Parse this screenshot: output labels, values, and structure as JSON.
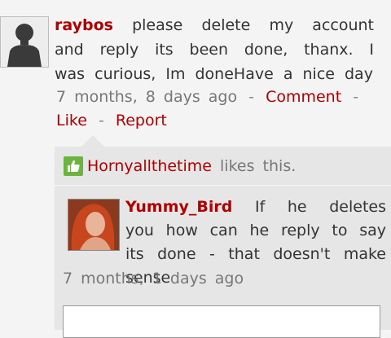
{
  "comment": {
    "username": "raybos",
    "text": "please delete my account and reply its been done, thanx. I was curious, Im doneHave a nice day",
    "time": "7 months, 8 days ago",
    "sep": "-",
    "comment_label": "Comment",
    "like_label": "Like",
    "report_label": "Report"
  },
  "likes": {
    "user": "Hornyallthetime",
    "text": "likes this."
  },
  "reply": {
    "username": "Yummy_Bird",
    "text": "If he deletes you how can he reply to say its done - that doesn't make sense",
    "time": "7 months, 1 days ago"
  },
  "colors": {
    "link": "#b00000",
    "like_icon": "#6db33f"
  }
}
